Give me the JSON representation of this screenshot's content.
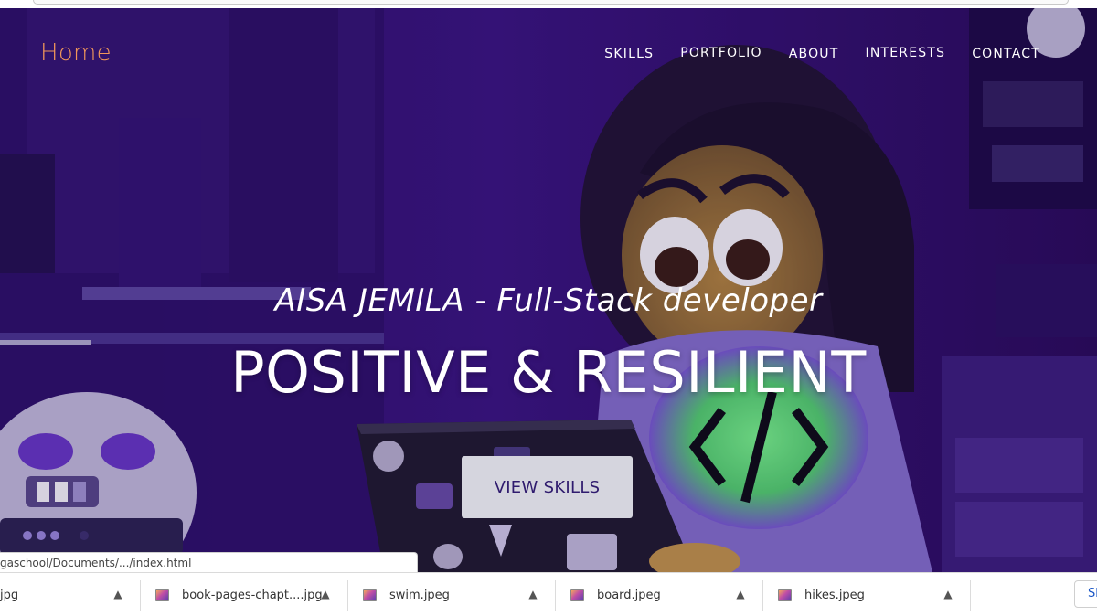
{
  "nav": {
    "home": "Home",
    "links": [
      "SKILLS",
      "PORTFOLIO",
      "ABOUT",
      "INTERESTS",
      "CONTACT"
    ]
  },
  "hero": {
    "subtitle": "AISA JEMILA - Full-Stack developer",
    "headline": "POSITIVE & RESILIENT",
    "cta": "VIEW SKILLS"
  },
  "status_url": "gaschool/Documents/.../index.html",
  "downloads": {
    "items": [
      "jpg",
      "book-pages-chapt....jpg",
      "swim.jpeg",
      "board.jpeg",
      "hikes.jpeg"
    ],
    "show_all": "Sh"
  },
  "colors": {
    "brand_orange": "#f0965a",
    "hero_purple": "#2a0f5e",
    "shirt_green": "#5cf07a",
    "button_bg": "#d5d5de",
    "button_text": "#2f1b6e"
  }
}
